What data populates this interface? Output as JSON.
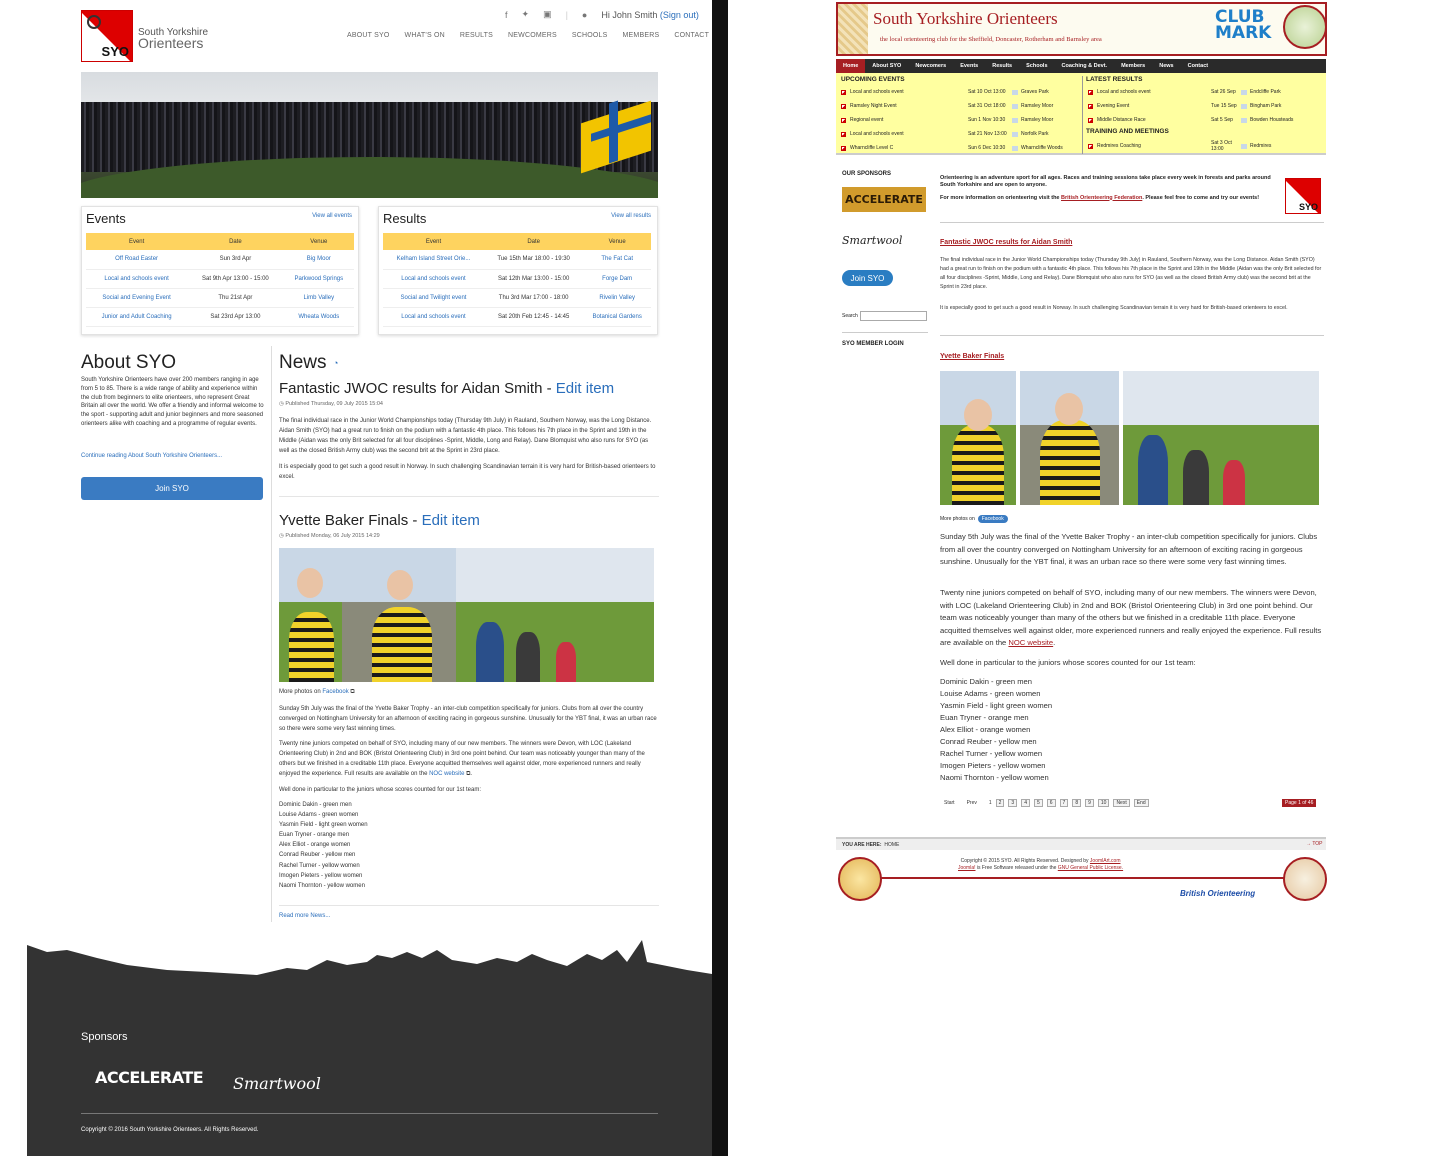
{
  "new_site": {
    "logo_text": "SYO",
    "brand_line1": "South Yorkshire",
    "brand_line2": "Orienteers",
    "user_text": "Hi John Smith",
    "signout": "(Sign out)",
    "nav": [
      "ABOUT SYO",
      "WHAT'S ON",
      "RESULTS",
      "NEWCOMERS",
      "SCHOOLS",
      "MEMBERS",
      "CONTACT"
    ],
    "events": {
      "title": "Events",
      "view_all": "View all events",
      "headers": [
        "Event",
        "Date",
        "Venue"
      ],
      "rows": [
        [
          "Off Road Easter",
          "Sun 3rd Apr",
          "Big Moor"
        ],
        [
          "Local and schools event",
          "Sat 9th Apr 13:00 - 15:00",
          "Parkwood Springs"
        ],
        [
          "Social and Evening Event",
          "Thu 21st Apr",
          "Limb Valley"
        ],
        [
          "Junior and Adult Coaching",
          "Sat 23rd Apr 13:00",
          "Wheata Woods"
        ]
      ]
    },
    "results": {
      "title": "Results",
      "view_all": "View all results",
      "headers": [
        "Event",
        "Date",
        "Venue"
      ],
      "rows": [
        [
          "Kelham Island Street Orie...",
          "Tue 15th Mar 18:00 - 19:30",
          "The Fat Cat"
        ],
        [
          "Local and schools event",
          "Sat 12th Mar 13:00 - 15:00",
          "Forge Dam"
        ],
        [
          "Social and Twilight event",
          "Thu 3rd Mar 17:00 - 18:00",
          "Rivelin Valley"
        ],
        [
          "Local and schools event",
          "Sat 20th Feb 12:45 - 14:45",
          "Botanical Gardens"
        ]
      ]
    },
    "about": {
      "title": "About SYO",
      "text": "South Yorkshire Orienteers have over 200 members ranging in age from 5 to 85. There is a wide range of ability and experience within the club from beginners to elite orienteers, who represent Great Britain all over the world. We offer a friendly and informal welcome to the sport - supporting adult and junior beginners and more seasoned orienteers alike with coaching and a programme of regular events.",
      "continue": "Continue reading About South Yorkshire Orienteers...",
      "join": "Join SYO"
    },
    "news": {
      "title": "News",
      "article1": {
        "title": "Fantastic JWOC results for Aidan Smith - ",
        "edit": "Edit item",
        "published": "Published Thursday, 09 July 2015 15:04",
        "p1": "The final individual race in the Junior World Championships today (Thursday 9th July) in Rauland, Southern Norway, was the Long Distance. Aidan Smith (SYO) had a great run to finish on the podium with a fantastic 4th place. This follows his 7th place in the Sprint and 19th in the Middle (Aidan was the only Brit selected for all four disciplines -Sprint, Middle, Long and Relay). Dane Blomquist who also runs for SYO (as well as the closed British Army club) was the second brit at the Sprint in 23rd place.",
        "p2": "It is especially good to get such a good result in Norway. In such challenging Scandinavian terrain it is very hard for British-based orienteers to excel."
      },
      "article2": {
        "title": "Yvette Baker Finals - ",
        "edit": "Edit item",
        "published": "Published Monday, 06 July 2015 14:29",
        "more_photos": "More photos on ",
        "facebook": "Facebook",
        "p1": "Sunday 5th July was the final of the Yvette Baker Trophy - an inter-club competition specifically for juniors. Clubs from all over the country converged on Nottingham University for an afternoon of exciting racing in gorgeous sunshine. Unusually for the YBT final, it was an urban race so there were some very fast winning times.",
        "p2": "Twenty nine juniors competed on behalf of SYO, including many of our new members. The winners were Devon, with LOC (Lakeland Orienteering Club) in 2nd and BOK (Bristol Orienteering Club) in 3rd one point behind. Our team was noticeably younger than many of the others but we finished in a creditable 11th place. Everyone acquitted themselves well against older, more experienced runners and really enjoyed the experience. Full results are available on the ",
        "noc": "NOC website",
        "p3": "Well done in particular to the juniors whose scores counted for our 1st team:"
      },
      "read_more": "Read more News..."
    },
    "team": [
      "Dominic Dakin - green men",
      "Louise Adams - green women",
      "Yasmin Field - light green women",
      "Euan Tryner - orange men",
      "Alex Elliot - orange women",
      "Conrad Reuber - yellow men",
      "Rachel Turner - yellow women",
      "Imogen Pieters - yellow women",
      "Naomi Thornton - yellow women"
    ],
    "footer": {
      "sponsors": "Sponsors",
      "accelerate": "ACCELERATE",
      "smartwool": "Smartwool",
      "copyright": "Copyright © 2016 South Yorkshire Orienteers. All Rights Reserved."
    }
  },
  "old_site": {
    "title": "South Yorkshire Orienteers",
    "subtitle": "the local orienteering club for the Sheffield, Doncaster, Rotherham and Barnsley area",
    "clubmark": [
      "CLUB",
      "MARK"
    ],
    "nav": [
      "Home",
      "About SYO",
      "Newcomers",
      "Events",
      "Results",
      "Schools",
      "Coaching & Devt.",
      "Members",
      "News",
      "Contact"
    ],
    "upcoming_title": "UPCOMING EVENTS",
    "upcoming": [
      [
        "Local and schools event",
        "Sat 10 Oct 13:00",
        "Graves Park"
      ],
      [
        "Ramsley Night Event",
        "Sat 31 Oct 18:00",
        "Ramsley Moor"
      ],
      [
        "Regional event",
        "Sun 1 Nov 10:30",
        "Ramsley Moor"
      ],
      [
        "Local and schools event",
        "Sat 21 Nov 13:00",
        "Norfolk Park"
      ],
      [
        "Wharncliffe Level C",
        "Sun 6 Dec 10:30",
        "Wharncliffe Woods"
      ]
    ],
    "latest_title": "LATEST RESULTS",
    "latest": [
      [
        "Local and schools event",
        "Sat 26 Sep",
        "Endcliffe Park"
      ],
      [
        "Evening Event",
        "Tue 15 Sep",
        "Bingham Park"
      ],
      [
        "Middle Distance Race",
        "Sat 5 Sep",
        "Bowden Housteads"
      ]
    ],
    "training_title": "TRAINING AND MEETINGS",
    "training": [
      [
        "Redmires Coaching",
        "Sat 3 Oct 13:00",
        "Redmires"
      ]
    ],
    "sponsors_title": "OUR SPONSORS",
    "accelerate": "ACCELERATE",
    "smartwool": "Smartwool",
    "join": "Join SYO",
    "search": "Search",
    "member_login": "SYO MEMBER LOGIN",
    "intro1": "Orienteering is an adventure sport for all ages. Races and training sessions take place every week in forests and parks around South Yorkshire and are open to anyone.",
    "intro2a": "For more information on orienteering visit the ",
    "intro2link": "British Orienteering Federation",
    "intro2b": ". Please feel free to come and try our events!",
    "logo_text": "SYO",
    "article1_title": "Fantastic JWOC results for Aidan Smith",
    "article2_title": "Yvette Baker Finals",
    "more_photos": "More photos on",
    "facebook": "Facebook",
    "noc": "NOC website",
    "pagination": [
      "Start",
      "Prev",
      "1",
      "2",
      "3",
      "4",
      "5",
      "6",
      "7",
      "8",
      "9",
      "10",
      "Next",
      "End"
    ],
    "page_of": "Page 1 of 46",
    "you_are_here": "YOU ARE HERE:",
    "home": "HOME",
    "top": "TOP",
    "copy1": "Copyright © 2015 SYO. All Rights Reserved. Designed by ",
    "joomlart": "JoomlArt.com",
    "joomla": "Joomla!",
    "copy2": " is Free Software released under the ",
    "gnu": "GNU General Public License.",
    "british": "British Orienteering"
  }
}
